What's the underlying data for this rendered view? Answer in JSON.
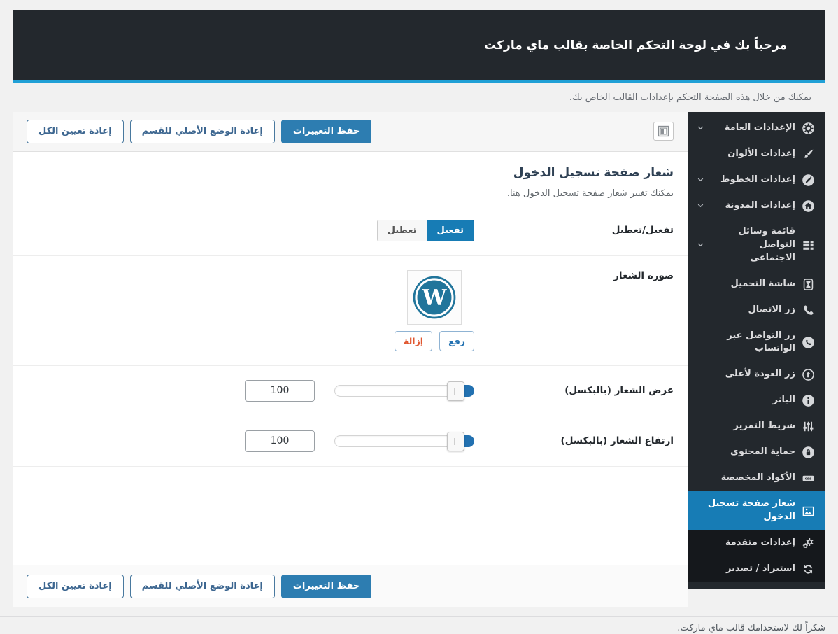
{
  "colors": {
    "page_bg": "#f1f1f1",
    "header_bg": "#23282d",
    "header_accent_line": "#21a0d6",
    "sidebar_bg": "#23282d",
    "sidebar_dark_bg": "#15181c",
    "active_item_bg": "#177cb5",
    "primary_button_bg": "#2d7db1",
    "link_blue": "#2271b1",
    "remove_red": "#e0562f",
    "wordpress_blue": "#21759b"
  },
  "header": {
    "title": "مرحباً بك في لوحة التحكم الخاصة بقالب ماي ماركت",
    "subtitle": "يمكنك من خلال هذه الصفحة التحكم بإعدادات القالب الخاص بك."
  },
  "sidebar": {
    "items": [
      {
        "id": "general-settings",
        "label": "الإعدادات العامة",
        "icon": "gear-circle",
        "chevron": true
      },
      {
        "id": "color-settings",
        "label": "إعدادات الألوان",
        "icon": "brush"
      },
      {
        "id": "font-settings",
        "label": "إعدادات الخطوط",
        "icon": "pencil-circle",
        "chevron": true
      },
      {
        "id": "blog-settings",
        "label": "إعدادات المدونة",
        "icon": "home-circle",
        "chevron": true
      },
      {
        "id": "social-media-menu",
        "label": "قائمة وسائل التواصل الاجتماعي",
        "icon": "list",
        "chevron": true
      },
      {
        "id": "loading-screen",
        "label": "شاشة التحميل",
        "icon": "hourglass"
      },
      {
        "id": "call-button",
        "label": "زر الاتصال",
        "icon": "phone"
      },
      {
        "id": "whatsapp-button",
        "label": "زر التواصل عبر الواتساب",
        "icon": "phone-circle"
      },
      {
        "id": "back-to-top-button",
        "label": "زر العودة لأعلى",
        "icon": "arrow-up-circle"
      },
      {
        "id": "banner",
        "label": "البانر",
        "icon": "info-circle"
      },
      {
        "id": "slider",
        "label": "شريط التمرير",
        "icon": "sliders"
      },
      {
        "id": "content-protection",
        "label": "حماية المحتوى",
        "icon": "lock-circle"
      },
      {
        "id": "custom-codes",
        "label": "الأكواد المخصصة",
        "icon": "css-badge"
      },
      {
        "id": "login-page-logo",
        "label": "شعار صفحة تسجيل الدخول",
        "icon": "image",
        "active": true
      },
      {
        "id": "advanced-settings",
        "label": "إعدادات متقدمة",
        "icon": "gears",
        "dark": true
      },
      {
        "id": "import-export",
        "label": "استيراد / تصدير",
        "icon": "sync",
        "dark": true
      }
    ]
  },
  "toolbar": {
    "save_label": "حفظ التغييرات",
    "reset_section_label": "إعادة الوضع الأصلي للقسم",
    "reset_all_label": "إعادة تعيين الكل",
    "panel_icon": "layout-panel-icon"
  },
  "section": {
    "title": "شعار صفحة تسجيل الدخول",
    "description": "يمكنك تغيير شعار صفحة تسجيل الدخول هنا.",
    "rows": {
      "toggle": {
        "label": "تفعيل/تعطيل",
        "on_label": "تفعيل",
        "off_label": "تعطيل",
        "state": "on"
      },
      "image": {
        "label": "صورة الشعار",
        "upload_label": "رفع",
        "remove_label": "إزالة",
        "image_name": "wordpress-logo"
      },
      "width": {
        "label": "عرض الشعار (بالبكسل)",
        "value": "100"
      },
      "height": {
        "label": "ارتفاع الشعار (بالبكسل)",
        "value": "100"
      }
    }
  },
  "footer": {
    "thanks": "شكراً لك لاستخدامك قالب ماي ماركت."
  }
}
